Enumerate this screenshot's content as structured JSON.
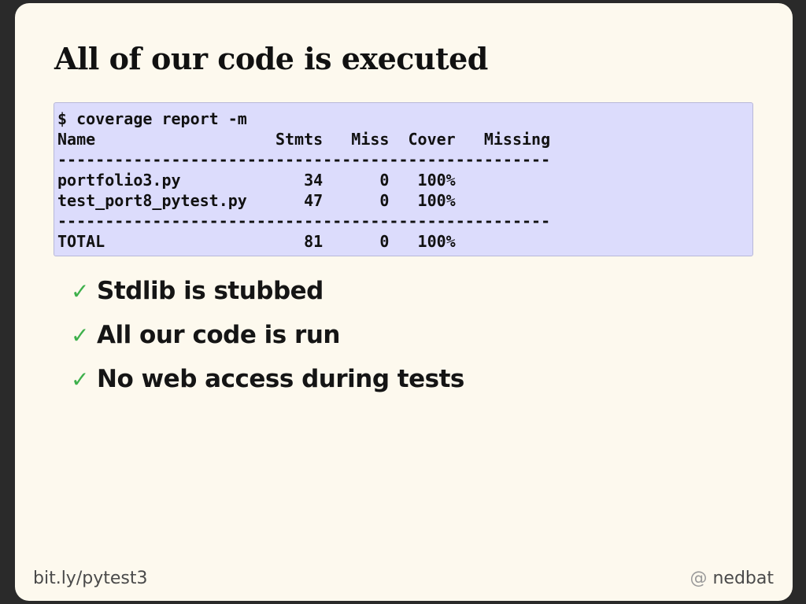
{
  "slide": {
    "title": "All of our code is executed",
    "code": {
      "command": "$ coverage report -m",
      "header": "Name                   Stmts   Miss  Cover   Missing",
      "separator": "----------------------------------------------------",
      "rows": [
        "portfolio3.py             34      0   100%",
        "test_port8_pytest.py      47      0   100%"
      ],
      "total": "TOTAL                     81      0   100%"
    },
    "bullets": [
      "Stdlib is stubbed",
      "All our code is run",
      "No web access during tests"
    ],
    "check_glyph": "✓",
    "check_color": "#3db04b",
    "footer": {
      "left_domain": "bit.ly/",
      "left_path": "pytest3",
      "right_at": "@",
      "right_handle": "nedbat"
    }
  }
}
